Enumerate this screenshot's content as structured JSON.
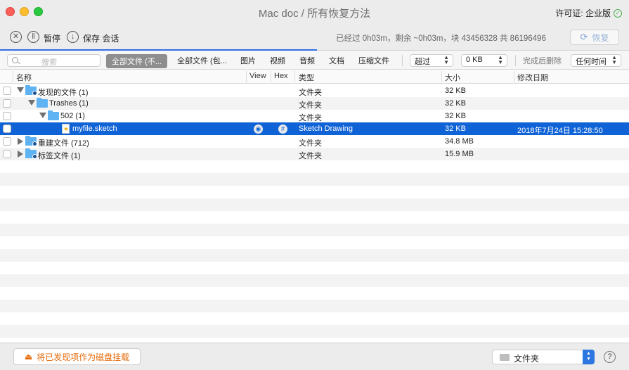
{
  "window": {
    "title": "Mac doc / 所有恢复方法",
    "license": "许可证: 企业版"
  },
  "toolbar": {
    "pause_label": "暂停",
    "save_label": "保存 会话",
    "progress": "已经过 0h03m，剩余 ~0h03m，块 43456328 共 86196496",
    "restore_label": "恢复",
    "accent_color": "#2e6fe6"
  },
  "filters": {
    "search_placeholder": "搜索",
    "tabs": [
      "全部文件 (不...",
      "全部文件 (包...",
      "图片",
      "视频",
      "音频",
      "文档",
      "压缩文件"
    ],
    "active_tab": 0,
    "size_op": "超过",
    "size_value": "0 KB",
    "delete_after": "完成后删除",
    "time_filter": "任何时间"
  },
  "columns": {
    "name": "名称",
    "view": "View",
    "hex": "Hex",
    "kind": "类型",
    "size": "大小",
    "date": "修改日期"
  },
  "rows": [
    {
      "name": "发现的文件 (1)",
      "kind": "文件夹",
      "size": "32 KB",
      "date": "",
      "icon": "folder-icon",
      "expanded": true
    },
    {
      "name": "Trashes (1)",
      "kind": "文件夹",
      "size": "32 KB",
      "date": "",
      "icon": "folder-icon",
      "expanded": true
    },
    {
      "name": "502 (1)",
      "kind": "文件夹",
      "size": "32 KB",
      "date": "",
      "icon": "folder-icon",
      "expanded": true
    },
    {
      "name": "myfile.sketch",
      "kind": "Sketch Drawing",
      "size": "32 KB",
      "date": "2018年7月24日 15:28:50",
      "icon": "sketch-file-icon",
      "selected": true
    },
    {
      "name": "重建文件 (712)",
      "kind": "文件夹",
      "size": "34.8 MB",
      "date": "",
      "icon": "folder-icon",
      "expanded": false
    },
    {
      "name": "标签文件 (1)",
      "kind": "文件夹",
      "size": "15.9 MB",
      "date": "",
      "icon": "folder-icon",
      "expanded": false
    }
  ],
  "bottom": {
    "mount_label": "将已发现项作为磁盘挂载",
    "kind_select": "文件夹",
    "help": "?"
  }
}
